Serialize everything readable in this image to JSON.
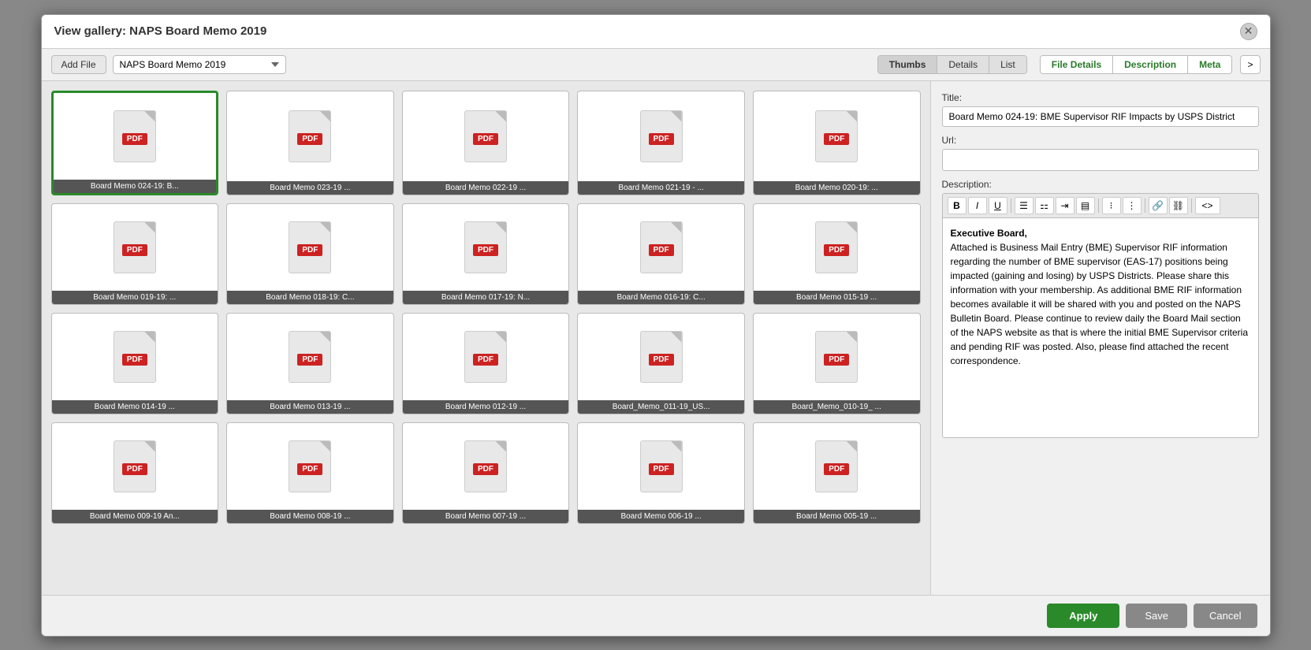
{
  "dialog": {
    "title_prefix": "View gallery: ",
    "title_bold": "NAPS Board Memo 2019"
  },
  "toolbar": {
    "add_file_label": "Add File",
    "gallery_select_value": "NAPS Board Memo 2019",
    "view_tabs": [
      {
        "label": "Thumbs",
        "active": true
      },
      {
        "label": "Details",
        "active": false
      },
      {
        "label": "List",
        "active": false
      }
    ],
    "detail_tabs": [
      {
        "label": "File Details",
        "active": false
      },
      {
        "label": "Description",
        "active": false
      },
      {
        "label": "Meta",
        "active": false
      }
    ],
    "more_label": ">"
  },
  "gallery": {
    "items": [
      {
        "label": "Board Memo 024-19: B...",
        "selected": true
      },
      {
        "label": "Board Memo 023-19  ...",
        "selected": false
      },
      {
        "label": "Board Memo 022-19  ...",
        "selected": false
      },
      {
        "label": "Board Memo 021-19 - ...",
        "selected": false
      },
      {
        "label": "Board Memo 020-19: ...",
        "selected": false
      },
      {
        "label": "Board Memo 019-19: ...",
        "selected": false
      },
      {
        "label": "Board Memo 018-19: C...",
        "selected": false
      },
      {
        "label": "Board Memo 017-19: N...",
        "selected": false
      },
      {
        "label": "Board Memo 016-19: C...",
        "selected": false
      },
      {
        "label": "Board Memo 015-19  ...",
        "selected": false
      },
      {
        "label": "Board Memo 014-19  ...",
        "selected": false
      },
      {
        "label": "Board Memo 013-19  ...",
        "selected": false
      },
      {
        "label": "Board Memo 012-19  ...",
        "selected": false
      },
      {
        "label": "Board_Memo_011-19_US...",
        "selected": false
      },
      {
        "label": "Board_Memo_010-19_ ...",
        "selected": false
      },
      {
        "label": "Board Memo 009-19 An...",
        "selected": false
      },
      {
        "label": "Board Memo 008-19  ...",
        "selected": false
      },
      {
        "label": "Board Memo 007-19  ...",
        "selected": false
      },
      {
        "label": "Board Memo 006-19  ...",
        "selected": false
      },
      {
        "label": "Board Memo 005-19  ...",
        "selected": false
      }
    ]
  },
  "side_panel": {
    "title_label": "Title:",
    "title_value": "Board Memo 024-19: BME Supervisor RIF Impacts by USPS District",
    "url_label": "Url:",
    "url_value": "",
    "url_placeholder": "",
    "description_label": "Description:",
    "editor_buttons": [
      {
        "label": "B",
        "name": "bold"
      },
      {
        "label": "I",
        "name": "italic"
      },
      {
        "label": "U",
        "name": "underline"
      },
      {
        "label": "≡",
        "name": "align-left"
      },
      {
        "label": "≡",
        "name": "align-center"
      },
      {
        "label": "≡",
        "name": "align-right"
      },
      {
        "label": "≡",
        "name": "align-justify"
      },
      {
        "label": "≔",
        "name": "unordered-list"
      },
      {
        "label": "≔",
        "name": "ordered-list"
      },
      {
        "label": "🔗",
        "name": "link"
      },
      {
        "label": "⛓",
        "name": "unlink"
      },
      {
        "label": "<>",
        "name": "source"
      }
    ],
    "description_content": "Executive Board,\n\nAttached is Business Mail Entry (BME) Supervisor RIF information regarding the number of BME supervisor (EAS-17) positions being impacted (gaining and losing) by USPS Districts. Please share this information with your membership.  As additional BME RIF information becomes available it will be shared with you and posted on the NAPS Bulletin Board.  Please continue to review daily the Board Mail section of the NAPS website as that is where the initial BME Supervisor criteria and pending RIF was posted. Also, please find attached the recent correspondence."
  },
  "footer": {
    "apply_label": "Apply",
    "save_label": "Save",
    "cancel_label": "Cancel"
  }
}
